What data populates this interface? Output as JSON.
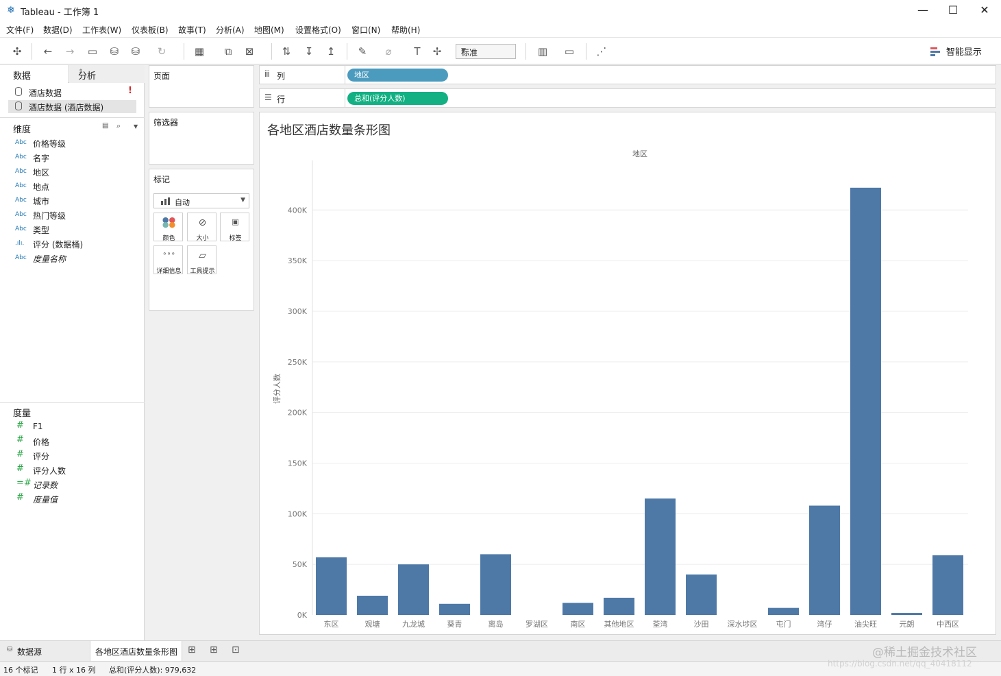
{
  "window": {
    "title": "Tableau - 工作簿 1"
  },
  "menu": [
    "文件(F)",
    "数据(D)",
    "工作表(W)",
    "仪表板(B)",
    "故事(T)",
    "分析(A)",
    "地图(M)",
    "设置格式(O)",
    "窗口(N)",
    "帮助(H)"
  ],
  "toolbar": {
    "fit_value": "标准",
    "show_me_label": "智能显示"
  },
  "data_pane": {
    "tab_data": "数据",
    "tab_analysis": "分析",
    "datasources": [
      "酒店数据",
      "酒店数据 (酒店数据)"
    ],
    "dimensions_title": "维度",
    "dimensions": [
      {
        "tag": "Abc",
        "name": "价格等级"
      },
      {
        "tag": "Abc",
        "name": "名字"
      },
      {
        "tag": "Abc",
        "name": "地区"
      },
      {
        "tag": "Abc",
        "name": "地点"
      },
      {
        "tag": "Abc",
        "name": "城市"
      },
      {
        "tag": "Abc",
        "name": "热门等级"
      },
      {
        "tag": "Abc",
        "name": "类型"
      },
      {
        "tag": ".ılı.",
        "name": "评分 (数据桶)"
      },
      {
        "tag": "Abc",
        "name": "度量名称"
      }
    ],
    "measures_title": "度量",
    "measures": [
      {
        "tag": "#",
        "name": "F1"
      },
      {
        "tag": "#",
        "name": "价格"
      },
      {
        "tag": "#",
        "name": "评分"
      },
      {
        "tag": "#",
        "name": "评分人数"
      },
      {
        "tag": "=#",
        "name": "记录数"
      },
      {
        "tag": "#",
        "name": "度量值"
      }
    ]
  },
  "cards": {
    "pages": "页面",
    "filters": "筛选器",
    "marks": "标记",
    "marks_type": "自动",
    "mark_buttons": [
      "颜色",
      "大小",
      "标签",
      "详细信息",
      "工具提示"
    ]
  },
  "shelves": {
    "columns_label": "列",
    "columns_pill": "地区",
    "rows_label": "行",
    "rows_pill": "总和(评分人数)"
  },
  "colors": {
    "bar": "#4e79a7",
    "columns_pill": "#4b9bbf",
    "rows_pill": "#12b083"
  },
  "view": {
    "title": "各地区酒店数量条形图"
  },
  "chart_data": {
    "type": "bar",
    "title": "各地区酒店数量条形图",
    "xlabel": "地区",
    "ylabel": "评分人数",
    "categories": [
      "东区",
      "观塘",
      "九龙城",
      "葵青",
      "离岛",
      "罗湖区",
      "南区",
      "其他地区",
      "荃湾",
      "沙田",
      "深水埗区",
      "屯门",
      "湾仔",
      "油尖旺",
      "元朗",
      "中西区"
    ],
    "values": [
      57000,
      19000,
      50000,
      11000,
      60000,
      0,
      12000,
      17000,
      115000,
      40000,
      0,
      7000,
      108000,
      422000,
      2000,
      59000
    ],
    "yticks": [
      "0K",
      "50K",
      "100K",
      "150K",
      "200K",
      "250K",
      "300K",
      "350K",
      "400K"
    ],
    "ylim": [
      0,
      430000
    ],
    "grid": true
  },
  "sheet_tabs": {
    "datasource": "数据源",
    "sheet": "各地区酒店数量条形图"
  },
  "status": {
    "marks": "16 个标记",
    "dims": "1 行 x 16 列",
    "sum": "总和(评分人数): 979,632"
  },
  "watermark": {
    "line1": "@稀土掘金技术社区",
    "line2": "https://blog.csdn.net/qq_40418112"
  }
}
